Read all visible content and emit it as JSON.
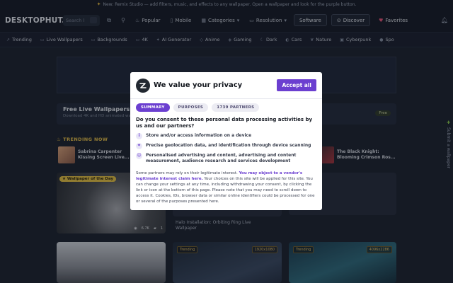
{
  "announcement": {
    "icon": "sparkle-icon",
    "text": "New: Remix Studio — add filters, music, and effects to any wallpaper. Open a wallpaper and look for the purple button."
  },
  "header": {
    "logo": "DESKTOPHUT.",
    "search_placeholder": "Search l",
    "nav": [
      {
        "icon": "flame-icon",
        "label": "Popular"
      },
      {
        "icon": "mobile-icon",
        "label": "Mobile"
      },
      {
        "icon": "grid-icon",
        "label": "Categories"
      },
      {
        "icon": "monitor-icon",
        "label": "Resolution"
      }
    ],
    "software_label": "Software",
    "discover_label": "Discover",
    "favorites_label": "Favorites"
  },
  "tags": [
    {
      "icon": "trending-icon",
      "label": "Trending"
    },
    {
      "icon": "video-icon",
      "label": "Live Wallpapers"
    },
    {
      "icon": "image-icon",
      "label": "Backgrounds"
    },
    {
      "icon": "monitor-icon",
      "label": "4K"
    },
    {
      "icon": "sparkle-icon",
      "label": "AI Generator"
    },
    {
      "icon": "tag-icon",
      "label": "Anime"
    },
    {
      "icon": "gamepad-icon",
      "label": "Gaming"
    },
    {
      "icon": "moon-icon",
      "label": "Dark"
    },
    {
      "icon": "car-icon",
      "label": "Cars"
    },
    {
      "icon": "leaf-icon",
      "label": "Nature"
    },
    {
      "icon": "chip-icon",
      "label": "Cyberpunk"
    },
    {
      "icon": "ball-icon",
      "label": "Spo"
    }
  ],
  "promo": {
    "title": "Free Live Wallpapers &",
    "subtitle": "Download 4K and HD animated wallpapers",
    "badge": "Free"
  },
  "trending": {
    "heading": "TRENDING NOW",
    "items": [
      {
        "title_line1": "Sabrina Carpenter",
        "title_line2": "Kissing Screen Live..."
      },
      {
        "title_line1": "The Black Knight:",
        "title_line2": "Blooming Crimson Ros..."
      }
    ]
  },
  "tiles": {
    "day_badge": "Wallpaper of the Day",
    "views": "6.7K",
    "likes": "1",
    "caption_line1": "Halo Installation: Orbiting Ring Live",
    "caption_line2": "Wallpaper",
    "trending_badge": "Trending",
    "res_1": "1920x1080",
    "res_2": "4096x2286"
  },
  "side": {
    "label": "Submit a wallpaper"
  },
  "consent": {
    "title": "We value your privacy",
    "accept_label": "Accept all",
    "tabs": [
      "SUMMARY",
      "PURPOSES",
      "1739 PARTNERS"
    ],
    "question": "Do you consent to these personal data processing activities by us and our partners?",
    "purposes": [
      {
        "icon": "info-icon",
        "text": "Store and/or access information on a device"
      },
      {
        "icon": "location-icon",
        "text": "Precise geolocation data, and identification through device scanning"
      },
      {
        "icon": "person-icon",
        "text": "Personalised advertising and content, advertising and content measurement, audience research and services development"
      }
    ],
    "legit_intro": "Some partners may rely on their legitimate interest. ",
    "legit_link": "You may object to a vendor's legitimate interest claim here.",
    "legit_rest": " Your choices on this site will be applied for this site. You can change your settings at any time, including withdrawing your consent, by clicking the link or icon at the bottom of this page. Please note that you may need to scroll down to access it. Cookies, IDs, browser data or similar online identifiers could be processed for one or several of the purposes presented here.",
    "accent": "#6b3fd0"
  }
}
